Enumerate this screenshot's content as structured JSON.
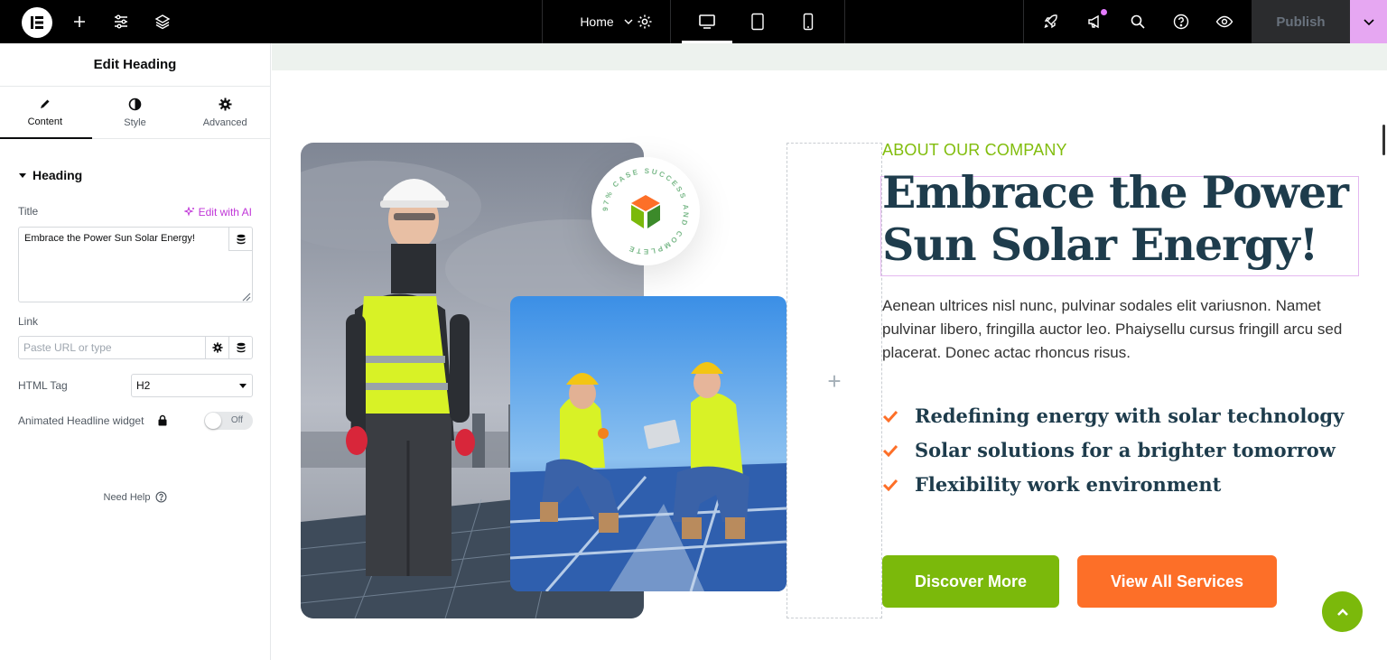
{
  "topbar": {
    "page_name": "Home",
    "publish_label": "Publish",
    "colors": {
      "bar": "#000000",
      "publish_bg": "#2b2c2e",
      "caret_bg": "#e6a7f2",
      "notification": "#e47bff"
    }
  },
  "panel": {
    "title": "Edit Heading",
    "tabs": [
      {
        "label": "Content",
        "icon": "pencil-icon",
        "active": true
      },
      {
        "label": "Style",
        "icon": "half-circle-icon",
        "active": false
      },
      {
        "label": "Advanced",
        "icon": "gear-icon",
        "active": false
      }
    ],
    "section_title": "Heading",
    "title_label": "Title",
    "edit_ai_label": "Edit with AI",
    "title_value": "Embrace the Power Sun Solar Energy!",
    "link_label": "Link",
    "link_placeholder": "Paste URL or type",
    "html_tag_label": "HTML Tag",
    "html_tag_value": "H2",
    "animated_label": "Animated Headline widget",
    "toggle_label": "Off",
    "need_help": "Need Help"
  },
  "canvas": {
    "eyebrow": "ABOUT OUR COMPANY",
    "heading": "Embrace the Power Sun Solar Energy!",
    "paragraph": "Aenean ultrices nisl nunc, pulvinar sodales elit variusnon. Namet pulvinar libero, fringilla auctor leo. Phaiysellu cursus fringill arcu sed placerat. Donec actac rhoncus risus.",
    "features": [
      "Redefining energy with solar technology",
      "Solar solutions for a brighter tomorrow",
      "Flexibility work environment"
    ],
    "badge_text": "97% CASE SUCCESS AND COMPLETE",
    "primary_button": "Discover More",
    "secondary_button": "View All Services",
    "colors": {
      "green": "#7bb90b",
      "orange": "#fd6f28",
      "navy": "#1e3c4c",
      "selection": "#e4b8f0"
    }
  }
}
